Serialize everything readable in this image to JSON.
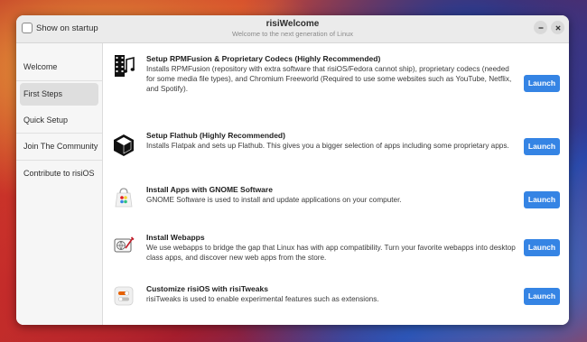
{
  "window": {
    "title": "risiWelcome",
    "subtitle": "Welcome to the next generation of Linux",
    "show_on_startup_label": "Show on startup"
  },
  "sidebar": {
    "items": [
      {
        "label": "Welcome"
      },
      {
        "label": "First Steps"
      },
      {
        "label": "Quick Setup"
      },
      {
        "label": "Join The Community"
      },
      {
        "label": "Contribute to risiOS"
      }
    ],
    "active": "First Steps"
  },
  "content": {
    "items": [
      {
        "icon": "film-music-icon",
        "title": "Setup RPMFusion & Proprietary Codecs (Highly Recommended)",
        "description": "Installs RPMFusion (repository with extra software that risiOS/Fedora cannot ship), proprietary codecs (needed for some media file types), and Chromium Freeworld (Required to use some websites such as YouTube, Netflix, and Spotify).",
        "button": "Launch"
      },
      {
        "icon": "flathub-icon",
        "title": "Setup Flathub (Highly Recommended)",
        "description": "Installs Flatpak and sets up Flathub. This gives you a bigger selection of apps including some proprietary apps.",
        "button": "Launch"
      },
      {
        "icon": "gnome-software-icon",
        "title": "Install Apps with GNOME Software",
        "description": "GNOME Software is used to install and update applications on your computer.",
        "button": "Launch"
      },
      {
        "icon": "webapps-icon",
        "title": "Install Webapps",
        "description": "We use webapps to bridge the gap that Linux has with app compatibility. Turn your favorite webapps into desktop class apps, and discover new web apps from the store.",
        "button": "Launch"
      },
      {
        "icon": "risitweaks-icon",
        "title": "Customize risiOS with risiTweaks",
        "description": "risiTweaks is used to enable experimental features such as extensions.",
        "button": "Launch"
      }
    ]
  },
  "colors": {
    "accent": "#3584e4",
    "window_bg": "#fafafa",
    "titlebar_bg": "#ebebeb"
  }
}
